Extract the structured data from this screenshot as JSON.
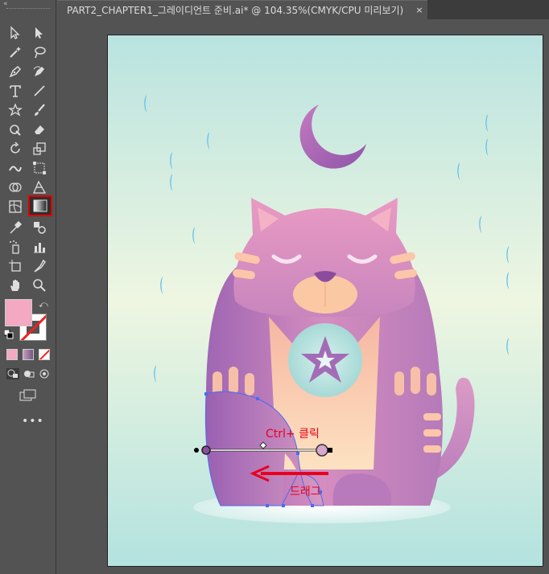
{
  "document_tab": {
    "title": "PART2_CHAPTER1_그레이디언트 준비.ai* @ 104.35%(CMYK/CPU 미리보기)",
    "close_glyph": "×"
  },
  "toolbar": {
    "collapse_glyph": "«",
    "more_glyph": "•••",
    "tools": [
      {
        "name": "selection-tool",
        "icon": "arrow-icon"
      },
      {
        "name": "direct-selection-tool",
        "icon": "filled-arrow-icon"
      },
      {
        "name": "magic-wand-tool",
        "icon": "magic-wand-icon"
      },
      {
        "name": "lasso-tool",
        "icon": "lasso-icon"
      },
      {
        "name": "pen-tool",
        "icon": "pen-icon"
      },
      {
        "name": "curvature-tool",
        "icon": "curvature-pen-icon"
      },
      {
        "name": "type-tool",
        "icon": "type-icon"
      },
      {
        "name": "line-tool",
        "icon": "line-icon"
      },
      {
        "name": "star-tool",
        "icon": "star-icon"
      },
      {
        "name": "paintbrush-tool",
        "icon": "brush-icon"
      },
      {
        "name": "shaper-tool",
        "icon": "shaper-icon"
      },
      {
        "name": "eraser-tool",
        "icon": "eraser-icon"
      },
      {
        "name": "rotate-tool",
        "icon": "rotate-icon"
      },
      {
        "name": "scale-tool",
        "icon": "scale-icon"
      },
      {
        "name": "warp-tool",
        "icon": "warp-icon"
      },
      {
        "name": "free-transform-tool",
        "icon": "free-transform-icon"
      },
      {
        "name": "shape-builder-tool",
        "icon": "shape-builder-icon"
      },
      {
        "name": "perspective-grid-tool",
        "icon": "perspective-icon"
      },
      {
        "name": "mesh-tool",
        "icon": "mesh-icon"
      },
      {
        "name": "gradient-tool",
        "icon": "gradient-icon",
        "active": true
      },
      {
        "name": "eyedropper-tool",
        "icon": "eyedropper-icon"
      },
      {
        "name": "blend-tool",
        "icon": "blend-icon"
      },
      {
        "name": "symbol-sprayer-tool",
        "icon": "symbol-sprayer-icon"
      },
      {
        "name": "column-graph-tool",
        "icon": "graph-icon"
      },
      {
        "name": "artboard-tool",
        "icon": "artboard-icon"
      },
      {
        "name": "slice-tool",
        "icon": "slice-icon"
      },
      {
        "name": "hand-tool",
        "icon": "hand-icon"
      },
      {
        "name": "zoom-tool",
        "icon": "zoom-icon"
      }
    ],
    "fill_color": "#f3a9c1",
    "stroke_color": "none"
  },
  "annotations": {
    "ctrl_click": "Ctrl+ 클릭",
    "drag": "드래그"
  },
  "colors": {
    "annotation_red": "#e8001c",
    "highlight_red": "#e00000",
    "cat_pink": "#e59ac0",
    "cat_purple": "#9b64b0",
    "moon_purple": "#a25fb2",
    "raindrop_blue": "#29a8e6"
  }
}
